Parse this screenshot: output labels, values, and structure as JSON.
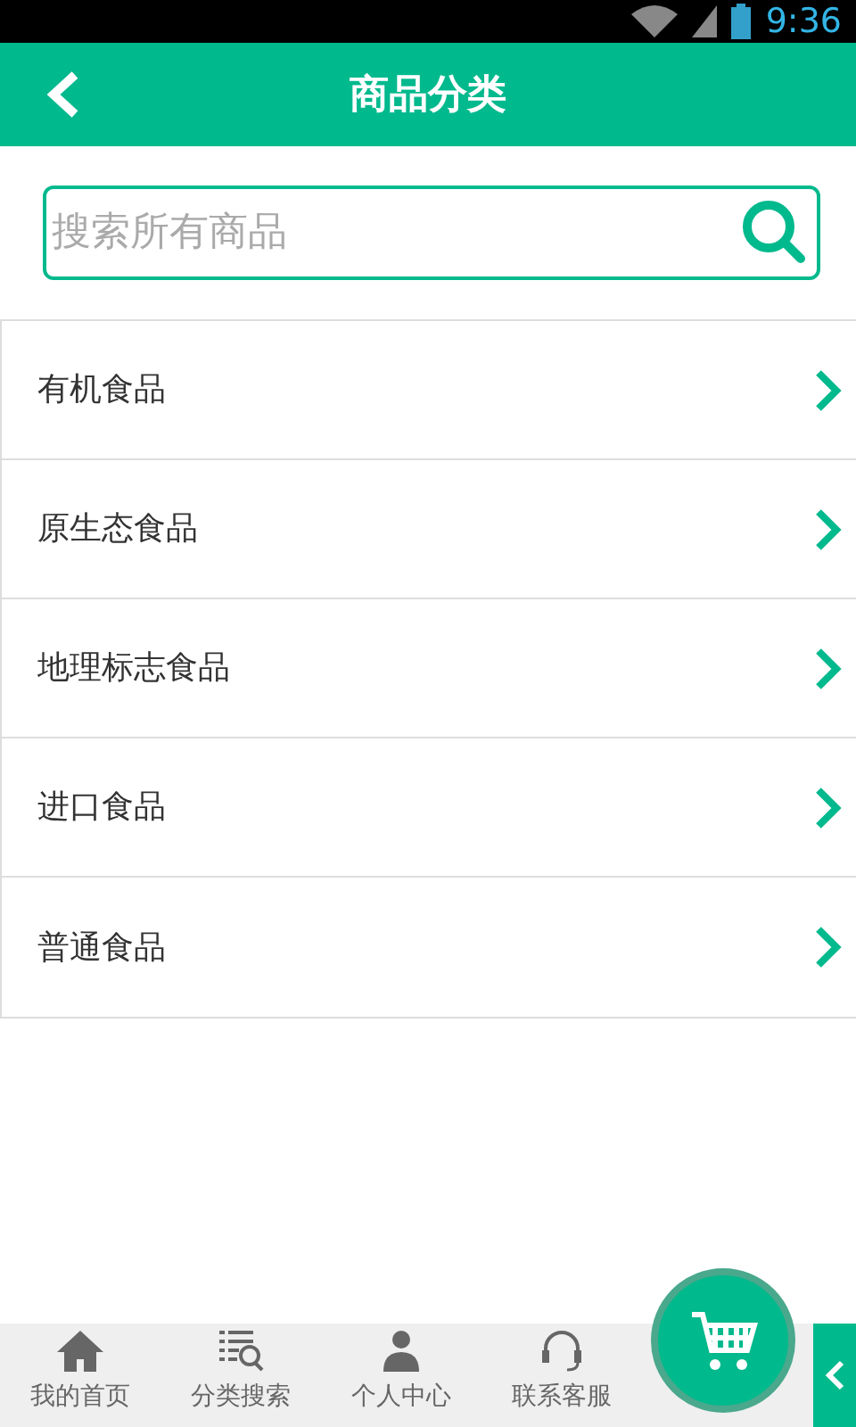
{
  "status_bar": {
    "time": "9:36"
  },
  "header": {
    "title": "商品分类"
  },
  "search": {
    "placeholder": "搜索所有商品"
  },
  "categories": [
    {
      "label": "有机食品"
    },
    {
      "label": "原生态食品"
    },
    {
      "label": "地理标志食品"
    },
    {
      "label": "进口食品"
    },
    {
      "label": "普通食品"
    }
  ],
  "bottom_nav": [
    {
      "label": "我的首页",
      "kind": "home"
    },
    {
      "label": "分类搜索",
      "kind": "search"
    },
    {
      "label": "个人中心",
      "kind": "person"
    },
    {
      "label": "联系客服",
      "kind": "headset"
    }
  ]
}
